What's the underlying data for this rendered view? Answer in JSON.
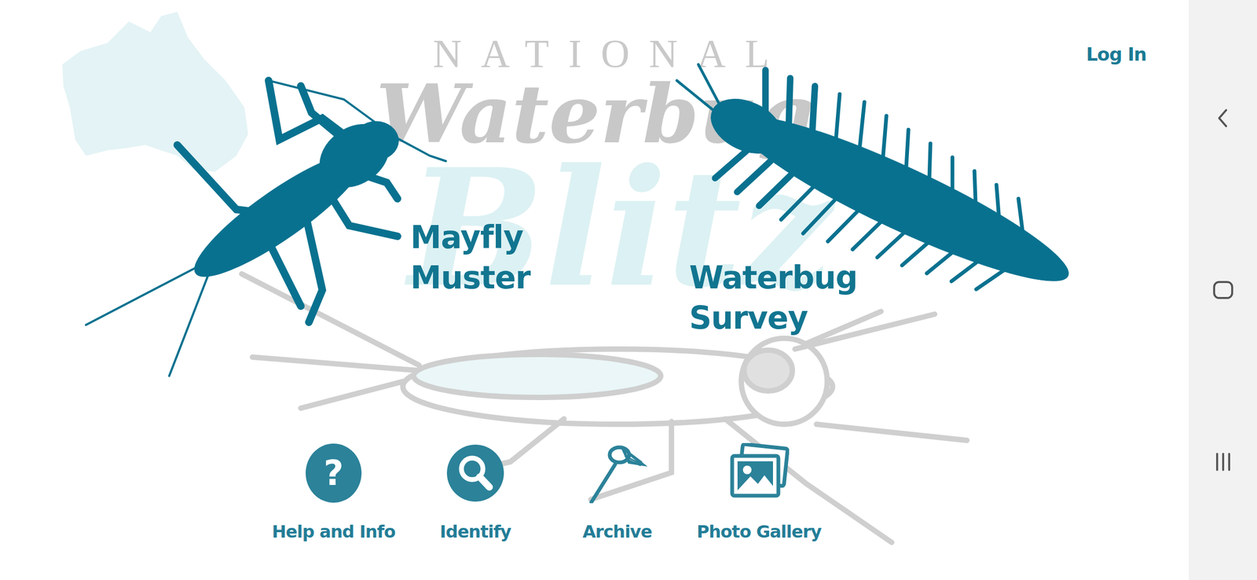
{
  "logo": {
    "top": "NATIONAL",
    "middle": "Waterbug",
    "script": "Blitz"
  },
  "header": {
    "login": "Log In"
  },
  "surveys": [
    {
      "label": "Mayfly Muster"
    },
    {
      "label": "Waterbug Survey"
    }
  ],
  "tools": [
    {
      "label": "Help and Info",
      "kind": "help",
      "glyph": "?"
    },
    {
      "label": "Identify",
      "kind": "identify"
    },
    {
      "label": "Archive",
      "kind": "archive"
    },
    {
      "label": "Photo Gallery",
      "kind": "gallery"
    }
  ],
  "system_nav": [
    {
      "kind": "back"
    },
    {
      "kind": "home"
    },
    {
      "kind": "recents"
    }
  ]
}
